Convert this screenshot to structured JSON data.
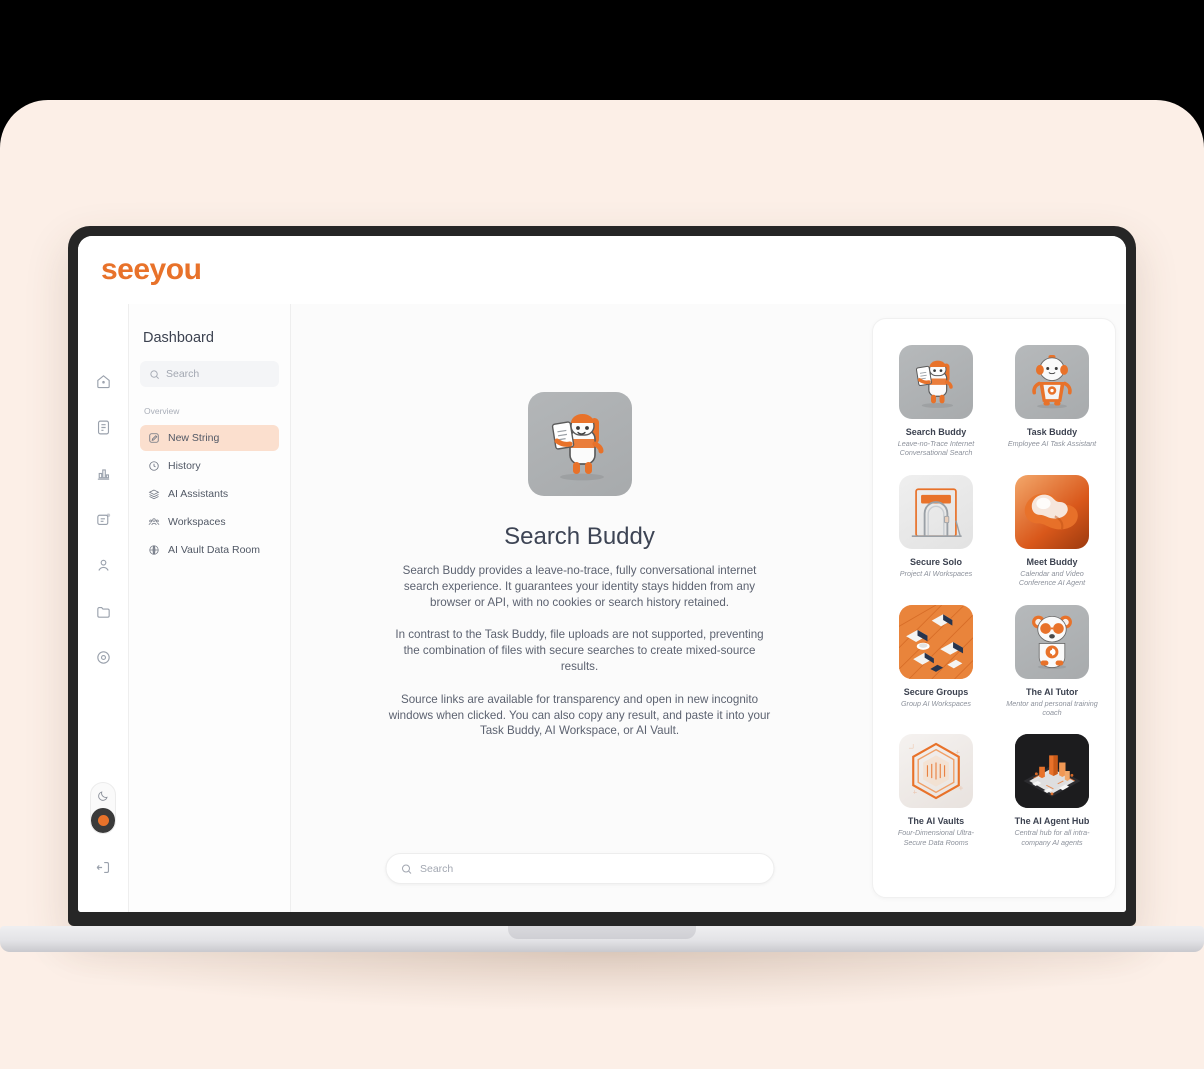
{
  "brand": {
    "logo_text": "seeyou",
    "accent_color": "#E8722A",
    "backdrop_color": "#FCEFE7"
  },
  "rail": {
    "icons": [
      {
        "name": "home-icon",
        "label": "Home"
      },
      {
        "name": "document-icon",
        "label": "Documents"
      },
      {
        "name": "bar-chart-icon",
        "label": "Analytics"
      },
      {
        "name": "notification-doc-icon",
        "label": "Notifications"
      },
      {
        "name": "person-icon",
        "label": "Profile"
      },
      {
        "name": "folder-icon",
        "label": "Files"
      },
      {
        "name": "settings-icon",
        "label": "Settings"
      }
    ],
    "mode_toggle": {
      "name": "dark-mode-toggle",
      "top_icon": "moon-icon",
      "bottom_icon": "active-dot"
    },
    "logout": {
      "name": "logout-icon",
      "label": "Log out"
    }
  },
  "sidebar": {
    "title": "Dashboard",
    "search_placeholder": "Search",
    "section_label": "Overview",
    "items": [
      {
        "label": "New String",
        "icon": "edit-square-icon",
        "active": true
      },
      {
        "label": "History",
        "icon": "clock-icon",
        "active": false
      },
      {
        "label": "AI Assistants",
        "icon": "layers-icon",
        "active": false
      },
      {
        "label": "Workspaces",
        "icon": "people-group-icon",
        "active": false
      },
      {
        "label": "AI Vault Data Room",
        "icon": "globe-shield-icon",
        "active": false
      }
    ]
  },
  "main": {
    "avatar_icon": "search-buddy-mascot",
    "title": "Search Buddy",
    "paragraphs": [
      "Search Buddy provides a leave-no-trace, fully conversational internet search experience. It guarantees your identity stays hidden from any browser or API, with no cookies or search history retained.",
      "In contrast to the Task Buddy, file uploads are not supported, preventing the combination of files with secure searches to create mixed-source results.",
      "Source links are available for transparency and open in new incognito windows when clicked. You can also copy any result, and paste it into your Task Buddy, AI Workspace, or AI Vault."
    ],
    "search_placeholder": "Search"
  },
  "assistants": [
    {
      "title": "Search Buddy",
      "subtitle": "Leave-no-Trace Internet Conversational Search",
      "thumb": "search-buddy-mascot",
      "bg": "bg-grey"
    },
    {
      "title": "Task Buddy",
      "subtitle": "Employee AI Task Assistant",
      "thumb": "task-buddy-mascot",
      "bg": "bg-grey"
    },
    {
      "title": "Secure Solo",
      "subtitle": "Project AI Workspaces",
      "thumb": "vault-door-icon",
      "bg": "bg-light"
    },
    {
      "title": "Meet Buddy",
      "subtitle": "Calendar and Video Conference AI Agent",
      "thumb": "speech-bubbles-icon",
      "bg": "bg-orange"
    },
    {
      "title": "Secure Groups",
      "subtitle": "Group AI Workspaces",
      "thumb": "isometric-desk-icon",
      "bg": "bg-iso"
    },
    {
      "title": "The AI Tutor",
      "subtitle": "Mentor and personal training coach",
      "thumb": "tutor-bear-mascot",
      "bg": "bg-grey"
    },
    {
      "title": "The AI Vaults",
      "subtitle": "Four-Dimensional Ultra-Secure Data Rooms",
      "thumb": "hexagon-vault-icon",
      "bg": "bg-vault"
    },
    {
      "title": "The AI Agent Hub",
      "subtitle": "Central hub for all intra-company AI agents",
      "thumb": "isometric-city-icon",
      "bg": "bg-dark"
    }
  ]
}
